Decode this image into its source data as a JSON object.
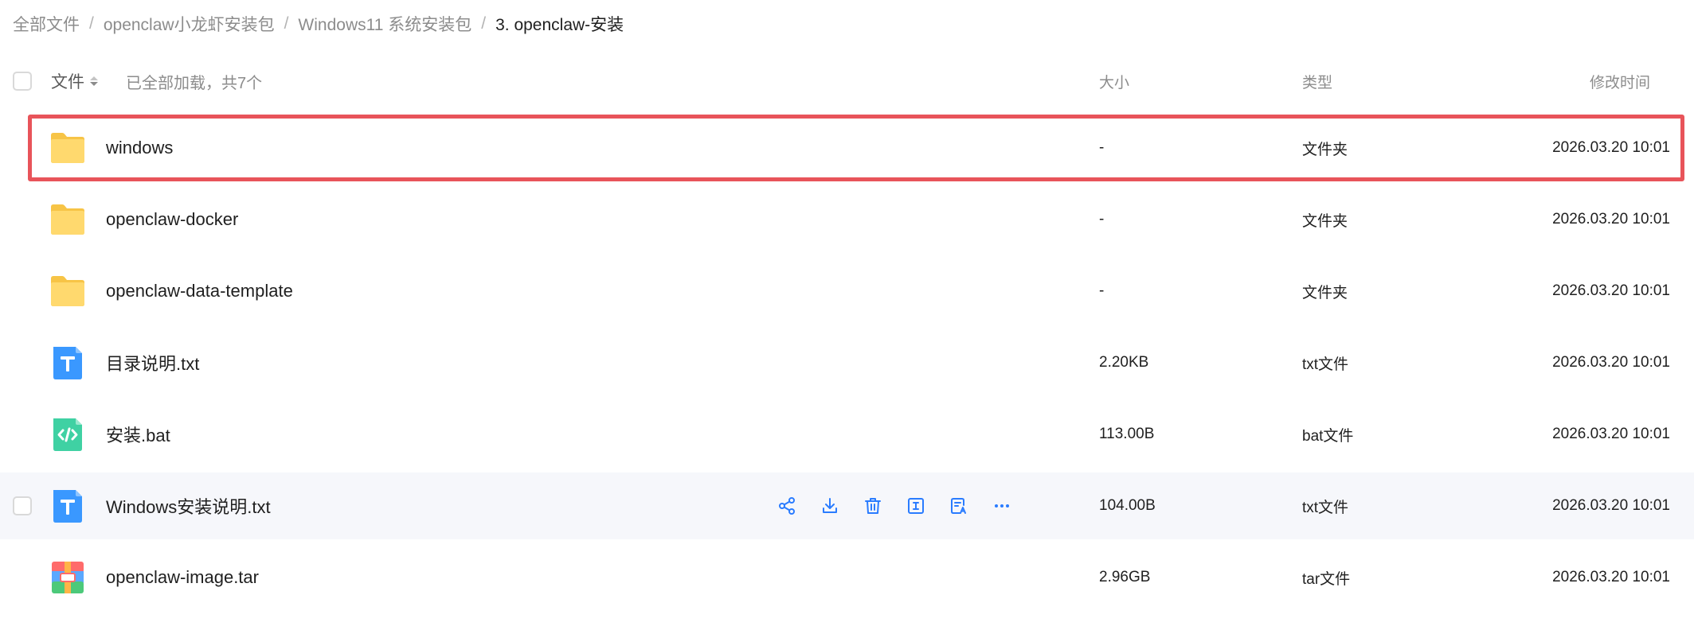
{
  "breadcrumb": [
    {
      "label": "全部文件"
    },
    {
      "label": "openclaw小龙虾安装包"
    },
    {
      "label": "Windows11 系统安装包"
    },
    {
      "label": "3. openclaw-安装"
    }
  ],
  "breadcrumb_separator": "/",
  "header": {
    "name_label": "文件",
    "loaded_text": "已全部加载，共7个",
    "size_label": "大小",
    "type_label": "类型",
    "time_label": "修改时间"
  },
  "files": [
    {
      "name": "windows",
      "size": "-",
      "type": "文件夹",
      "time": "2026.03.20 10:01",
      "icon": "folder-icon",
      "selected": true
    },
    {
      "name": "openclaw-docker",
      "size": "-",
      "type": "文件夹",
      "time": "2026.03.20 10:01",
      "icon": "folder-icon"
    },
    {
      "name": "openclaw-data-template",
      "size": "-",
      "type": "文件夹",
      "time": "2026.03.20 10:01",
      "icon": "folder-icon"
    },
    {
      "name": "目录说明.txt",
      "size": "2.20KB",
      "type": "txt文件",
      "time": "2026.03.20 10:01",
      "icon": "txt-file-icon"
    },
    {
      "name": "安装.bat",
      "size": "113.00B",
      "type": "bat文件",
      "time": "2026.03.20 10:01",
      "icon": "code-file-icon"
    },
    {
      "name": "Windows安装说明.txt",
      "size": "104.00B",
      "type": "txt文件",
      "time": "2026.03.20 10:01",
      "icon": "txt-file-icon",
      "hovered": true
    },
    {
      "name": "openclaw-image.tar",
      "size": "2.96GB",
      "type": "tar文件",
      "time": "2026.03.20 10:01",
      "icon": "archive-file-icon"
    }
  ],
  "row_actions": [
    "share-icon",
    "download-icon",
    "delete-icon",
    "rename-icon",
    "move-icon",
    "more-icon"
  ],
  "colors": {
    "accent": "#2a7cff",
    "selection_border": "#e8545a",
    "hover_row": "#f6f7fb",
    "folder": "#ffd56b",
    "txt_icon": "#3a98ff",
    "code_icon": "#3fd1a3"
  }
}
